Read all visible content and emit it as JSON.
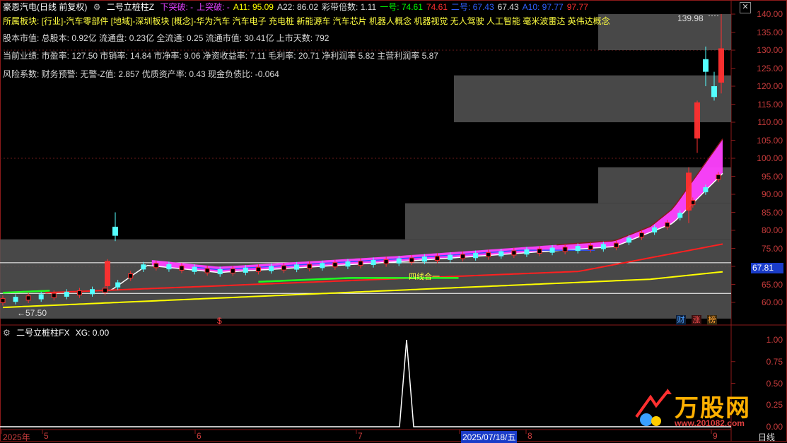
{
  "header": {
    "title": "豪恩汽电(日线 前复权)",
    "indicator_name": "二号立桩柱Z",
    "items": [
      {
        "label": "下突破:",
        "value": "-",
        "color": "#e040fb"
      },
      {
        "label": "上突破:",
        "value": "-",
        "color": "#e040fb"
      },
      {
        "label": "A11:",
        "value": "95.09",
        "color": "#ffff00"
      },
      {
        "label": "A22:",
        "value": "86.02",
        "color": "#dddddd"
      },
      {
        "label": "彩带倍数:",
        "value": "1.11",
        "color": "#dddddd"
      },
      {
        "label": "一号:",
        "value": "74.61",
        "color": "#00ff00"
      },
      {
        "label": "",
        "value": "74.61",
        "color": "#ff3030"
      },
      {
        "label": "二号:",
        "value": "67.43",
        "color": "#3060ff"
      },
      {
        "label": "",
        "value": "67.43",
        "color": "#dddddd"
      },
      {
        "label": "A10:",
        "value": "97.77",
        "color": "#3060ff"
      },
      {
        "label": "",
        "value": "97.77",
        "color": "#ff3030"
      }
    ]
  },
  "info": {
    "sector_row": "所属板块: [行业]-汽车零部件 [地域]-深圳板块 [概念]-华为汽车 汽车电子 充电桩 新能源车 汽车芯片 机器人概念 机器视觉 无人驾驶 人工智能 毫米波雷达 英伟达概念",
    "capital_row": "股本市值: 总股本: 0.92亿 流通盘: 0.23亿 全流通: 0.25 流通市值: 30.41亿 上市天数: 792",
    "perf_row": "当前业绩: 市盈率: 127.50 市销率: 14.84 市净率: 9.06 净资收益率: 7.11 毛利率: 20.71 净利润率 5.82 主营利润率 5.87",
    "risk_row": "风险系数: 财务预警: 无警-Z值: 2.857 优质资产率: 0.43 现金负债比: -0.064"
  },
  "price_axis": {
    "labels": [
      "140.00",
      "135.00",
      "130.00",
      "125.00",
      "120.00",
      "115.00",
      "110.00",
      "105.00",
      "100.00",
      "95.00",
      "90.00",
      "85.00",
      "80.00",
      "75.00",
      "70.00",
      "65.00",
      "60.00"
    ],
    "current_price": "67.81",
    "high_label": "139.98",
    "low_label": "57.50"
  },
  "annotations": {
    "platform_label": "四线合一",
    "dollar_mark": "$"
  },
  "badges": [
    {
      "text": "财",
      "color": "#4aa0ff",
      "bg": "#10203a"
    },
    {
      "text": "涨",
      "color": "#ff5050",
      "bg": "#3a1010"
    },
    {
      "text": "榜",
      "color": "#ffa030",
      "bg": "#3a2a10"
    }
  ],
  "sub_panel": {
    "title": "二号立桩柱FX",
    "value_text": "XG: 0.00",
    "axis_labels": [
      "1.00",
      "0.75",
      "0.50",
      "0.25",
      "0.00"
    ]
  },
  "date_axis": {
    "labels": [
      {
        "text": "2025年"
      },
      {
        "text": "5"
      },
      {
        "text": "6"
      },
      {
        "text": "7"
      },
      {
        "text": "2025/07/18/五"
      },
      {
        "text": "8"
      },
      {
        "text": "9"
      }
    ],
    "period": "日线"
  },
  "watermark": {
    "brand": "万股网",
    "url": "www.201082.com"
  },
  "colors": {
    "up": "#ff3030",
    "down": "#54ffff",
    "ma_yellow": "#ffff00",
    "ma_red": "#ff2020",
    "ma_blue": "#3050ff",
    "ribbon": "#ff40ff",
    "ma_green": "#20ff20",
    "zone": "#555555"
  },
  "icons": {
    "settings": "gear-icon",
    "close": "close-icon",
    "expand": "caret-up-icon"
  }
}
